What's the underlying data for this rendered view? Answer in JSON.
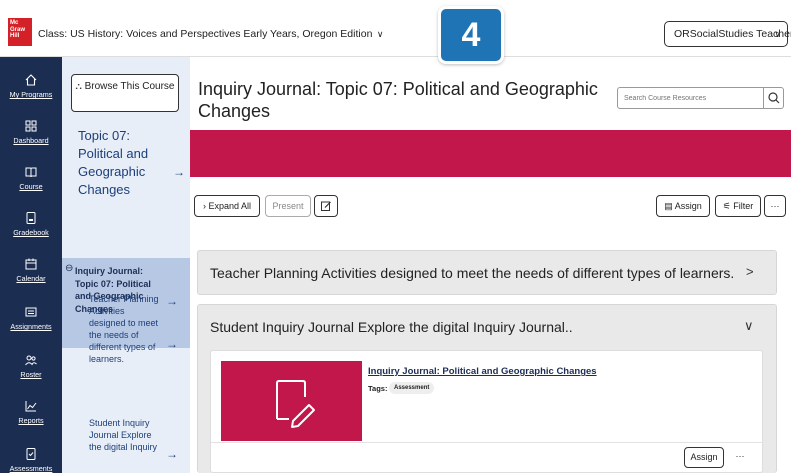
{
  "header": {
    "logo_text": "Mc Graw Hill",
    "class_title": "Class: US History: Voices and Perspectives Early Years, Oregon Edition",
    "step_number": "4",
    "user_name": "ORSocialStudies Teacher"
  },
  "rail": {
    "items": [
      {
        "label": "My Programs",
        "icon": "home-icon"
      },
      {
        "label": "Dashboard",
        "icon": "dashboard-icon"
      },
      {
        "label": "Course",
        "icon": "book-icon"
      },
      {
        "label": "Gradebook",
        "icon": "gradebook-icon"
      },
      {
        "label": "Calendar",
        "icon": "calendar-icon"
      },
      {
        "label": "Assignments",
        "icon": "assignments-icon"
      },
      {
        "label": "Roster",
        "icon": "roster-icon"
      },
      {
        "label": "Reports",
        "icon": "reports-icon"
      },
      {
        "label": "Assessments",
        "icon": "assessments-icon"
      }
    ]
  },
  "panel": {
    "browse_label": "Browse This Course",
    "topic_label": "Topic 07: Political and Geographic Changes",
    "active_item": "Inquiry Journal: Topic 07: Political and Geographic Changes",
    "sub_items": [
      "Teacher Planning Activities designed to meet the needs of different types of learners.",
      "Student Inquiry Journal Explore the digital Inquiry"
    ]
  },
  "main": {
    "title": "Inquiry Journal: Topic 07: Political and Geographic Changes",
    "search_placeholder": "Search Course Resources",
    "toolbar": {
      "expand_all": "Expand All",
      "present": "Present",
      "assign": "Assign",
      "filter": "Filter",
      "more": "···"
    },
    "sections": [
      {
        "title": "Teacher Planning Activities designed to meet the needs of different types of learners."
      },
      {
        "title": "Student Inquiry Journal Explore the digital Inquiry Journal.."
      }
    ],
    "card": {
      "title": "Inquiry Journal: Political and Geographic Changes",
      "tags_label": "Tags:",
      "tag": "Assessment",
      "assign_label": "Assign",
      "more": "···"
    }
  },
  "colors": {
    "rail_bg": "#1b2e52",
    "panel_bg": "#e8eef7",
    "active_bg": "#b6c8e4",
    "banner": "#c2174a",
    "badge": "#1f74b5",
    "logo": "#d42027"
  }
}
